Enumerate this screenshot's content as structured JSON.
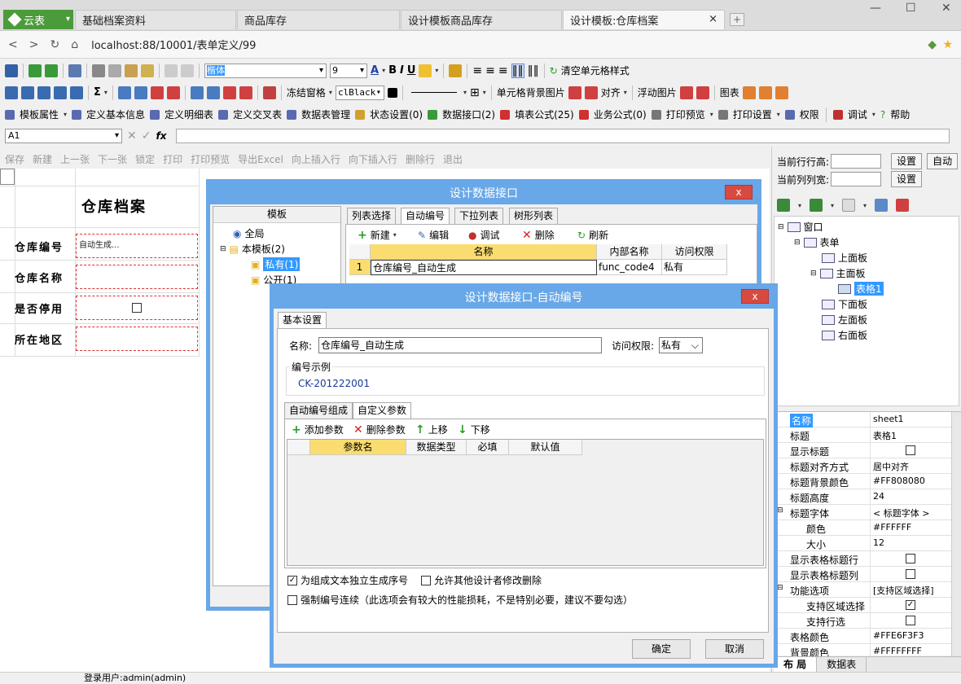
{
  "tabs": {
    "brand": "云表",
    "items": [
      "基础档案资料",
      "商品库存",
      "设计模板商品库存",
      "设计模板:仓库档案"
    ]
  },
  "address": {
    "url": "localhost:88/10001/表单定义/99"
  },
  "toolbar1": {
    "font": "楷体",
    "size": "9",
    "clear_style": "清空单元格样式"
  },
  "toolbar2": {
    "freeze": "冻结窗格",
    "color_name": "clBlack",
    "cell_bg_image": "单元格背景图片",
    "align": "对齐",
    "float_image": "浮动图片",
    "chart": "图表"
  },
  "toolbar3": {
    "items": [
      "模板属性",
      "定义基本信息",
      "定义明细表",
      "定义交叉表",
      "数据表管理",
      "状态设置(0)",
      "数据接口(2)",
      "填表公式(25)",
      "业务公式(0)",
      "打印预览",
      "打印设置",
      "权限",
      "调试",
      "帮助"
    ]
  },
  "formula": {
    "cell": "A1",
    "fx": "fx"
  },
  "actions": [
    "保存",
    "新建",
    "上一张",
    "下一张",
    "锁定",
    "打印",
    "打印预览",
    "导出Excel",
    "向上插入行",
    "向下插入行",
    "删除行",
    "退出"
  ],
  "form": {
    "title": "仓库档案",
    "labels": [
      "仓库编号",
      "仓库名称",
      "是否停用",
      "所在地区"
    ],
    "autogen": "自动生成..."
  },
  "right": {
    "row_height_label": "当前行行高:",
    "col_width_label": "当前列列宽:",
    "set": "设置",
    "auto": "自动",
    "tree": [
      "窗口",
      "表单",
      "上面板",
      "主面板",
      "表格1",
      "下面板",
      "左面板",
      "右面板"
    ]
  },
  "props": [
    {
      "k": "名称",
      "v": "sheet1"
    },
    {
      "k": "标题",
      "v": "表格1"
    },
    {
      "k": "显示标题",
      "v": ""
    },
    {
      "k": "标题对齐方式",
      "v": "居中对齐"
    },
    {
      "k": "标题背景颜色",
      "v": "#FF808080"
    },
    {
      "k": "标题高度",
      "v": "24"
    },
    {
      "k": "标题字体",
      "v": "< 标题字体 >"
    },
    {
      "k": "颜色",
      "v": "#FFFFFF"
    },
    {
      "k": "大小",
      "v": "12"
    },
    {
      "k": "显示表格标题行",
      "v": ""
    },
    {
      "k": "显示表格标题列",
      "v": ""
    },
    {
      "k": "功能选项",
      "v": "[支持区域选择]"
    },
    {
      "k": "支持区域选择",
      "v": ""
    },
    {
      "k": "支持行选",
      "v": ""
    },
    {
      "k": "表格颜色",
      "v": "#FFE6F3F3"
    },
    {
      "k": "背景颜色",
      "v": "#FFFFFFFF"
    }
  ],
  "bottom_tabs": [
    "布 局",
    "数据表"
  ],
  "status": {
    "user": "登录用户:admin(admin)"
  },
  "dialog1": {
    "title": "设计数据接口",
    "close": "x",
    "left_header": "模板",
    "left_tree": [
      "全局",
      "本模板(2)",
      "私有(1)",
      "公开(1)"
    ],
    "tabs": [
      "列表选择",
      "自动编号",
      "下拉列表",
      "树形列表"
    ],
    "tools": [
      "新建",
      "编辑",
      "调试",
      "删除",
      "刷新"
    ],
    "columns": [
      "名称",
      "内部名称",
      "访问权限"
    ],
    "row": {
      "idx": "1",
      "name": "仓库编号_自动生成",
      "code": "func_code4",
      "access": "私有"
    }
  },
  "dialog2": {
    "title": "设计数据接口-自动编号",
    "close": "x",
    "tab": "基本设置",
    "name_label": "名称:",
    "name_value": "仓库编号_自动生成",
    "access_label": "访问权限:",
    "access_value": "私有",
    "example_label": "编号示例",
    "example_value": "CK-201222001",
    "subtabs": [
      "自动编号组成",
      "自定义参数"
    ],
    "subtools": [
      "添加参数",
      "删除参数",
      "上移",
      "下移"
    ],
    "columns": [
      "参数名",
      "数据类型",
      "必填",
      "默认值"
    ],
    "opt1": "为组成文本独立生成序号",
    "opt2": "允许其他设计者修改删除",
    "opt3": "强制编号连续（此选项会有较大的性能损耗，不是特别必要，建议不要勾选）",
    "ok": "确定",
    "cancel": "取消"
  }
}
